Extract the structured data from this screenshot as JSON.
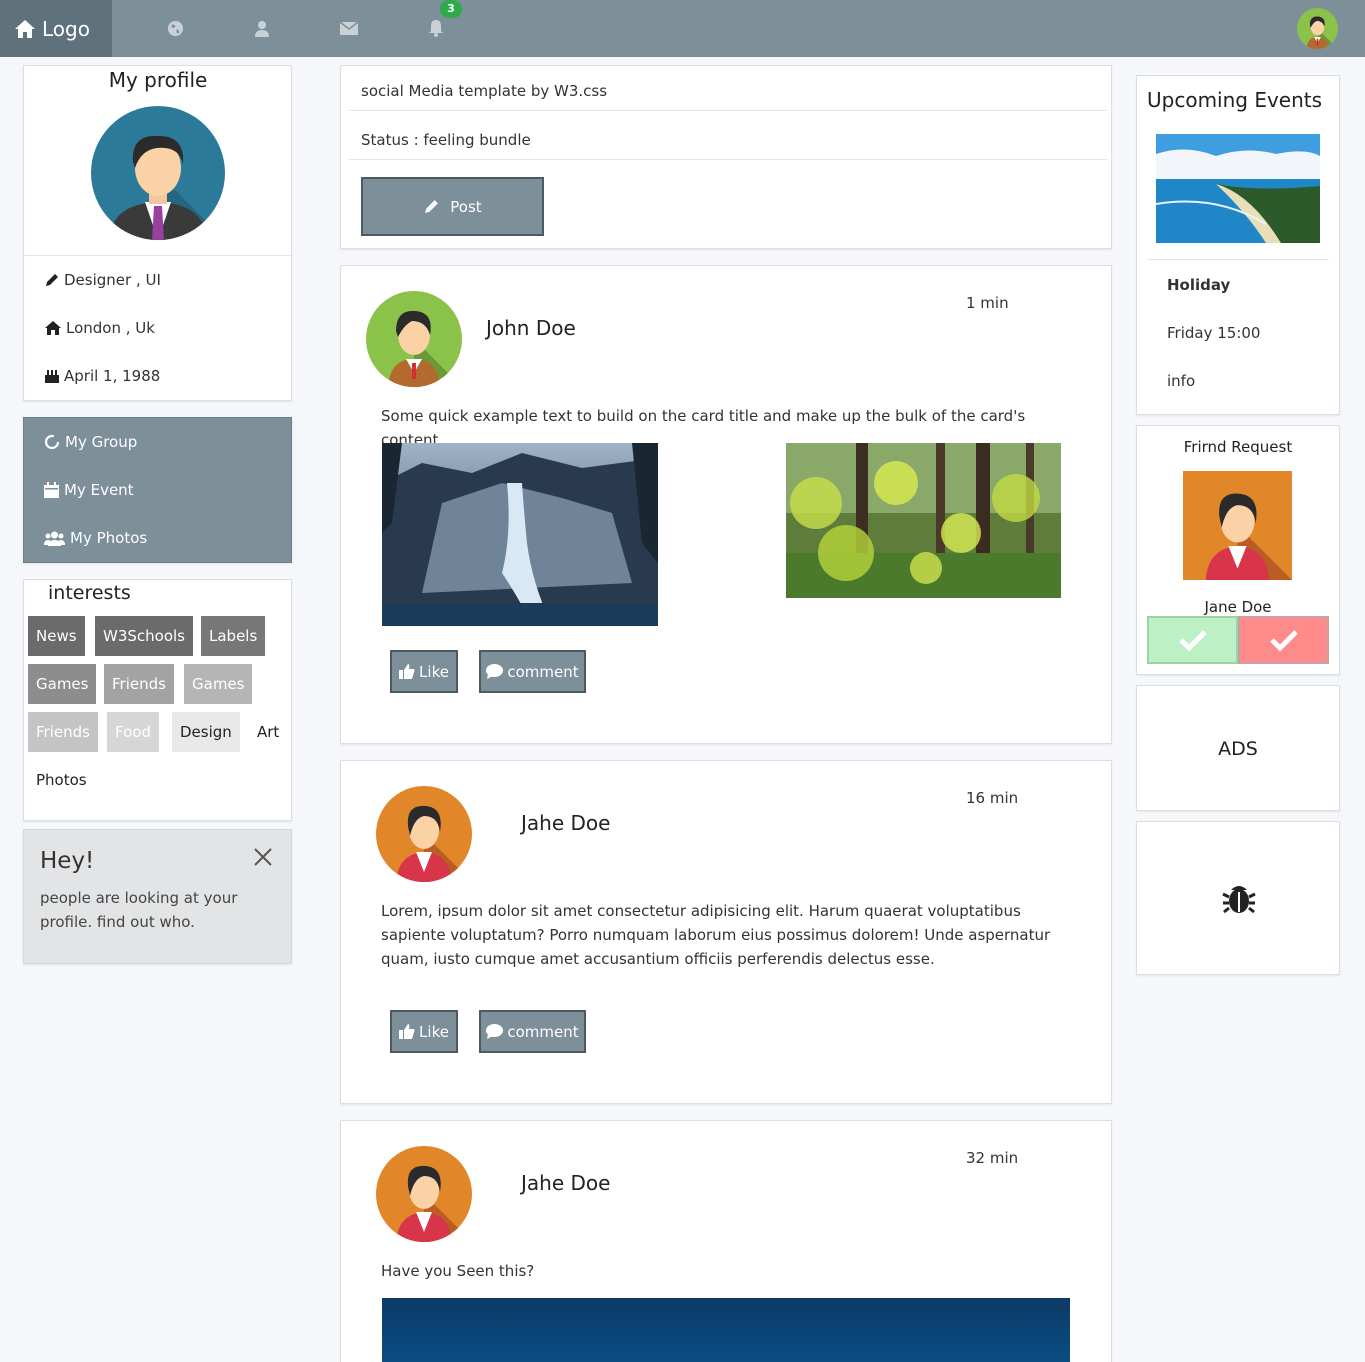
{
  "nav": {
    "logo_label": "Logo",
    "icons": [
      "globe-icon",
      "user-icon",
      "envelope-icon",
      "bell-icon"
    ],
    "notification_count": "3"
  },
  "profile": {
    "title": "My profile",
    "job": "Designer , UI",
    "location": "London , Uk",
    "birthday": "April 1, 1988"
  },
  "menu": {
    "items": [
      {
        "label": "My Group",
        "icon": "circle-notch-icon"
      },
      {
        "label": "My Event",
        "icon": "calendar-icon"
      },
      {
        "label": "My Photos",
        "icon": "users-icon"
      }
    ]
  },
  "interests": {
    "title": "interests",
    "tags": [
      "News",
      "W3Schools",
      "Labels",
      "Games",
      "Friends",
      "Games",
      "Friends",
      "Food",
      "Design",
      "Art",
      "Photos"
    ]
  },
  "alert": {
    "title": "Hey!",
    "text": "people are looking at your profile. find out who."
  },
  "composer": {
    "title": "social Media template by W3.css",
    "status": "Status : feeling bundle",
    "post_label": "Post"
  },
  "posts": [
    {
      "name": "John Doe",
      "time": "1 min",
      "text": "Some quick example text to build on the card title and make up the bulk of the card's content.",
      "like_label": "Like",
      "comment_label": "comment"
    },
    {
      "name": "Jahe Doe",
      "time": "16 min",
      "text": "Lorem, ipsum dolor sit amet consectetur adipisicing elit. Harum quaerat voluptatibus sapiente voluptatum? Porro numquam laborum eius possimus dolorem! Unde aspernatur quam, iusto cumque amet accusantium officiis perferendis delectus esse.",
      "like_label": "Like",
      "comment_label": "comment"
    },
    {
      "name": "Jahe Doe",
      "time": "32 min",
      "text": "Have you Seen this?"
    }
  ],
  "events": {
    "title": "Upcoming Events",
    "name": "Holiday",
    "when": "Friday 15:00",
    "info": "info"
  },
  "friend_request": {
    "title": "Frirnd Request",
    "name": "Jane Doe"
  },
  "ads": {
    "label": "ADS"
  },
  "bug_card": {
    "icon": "bug-icon"
  }
}
